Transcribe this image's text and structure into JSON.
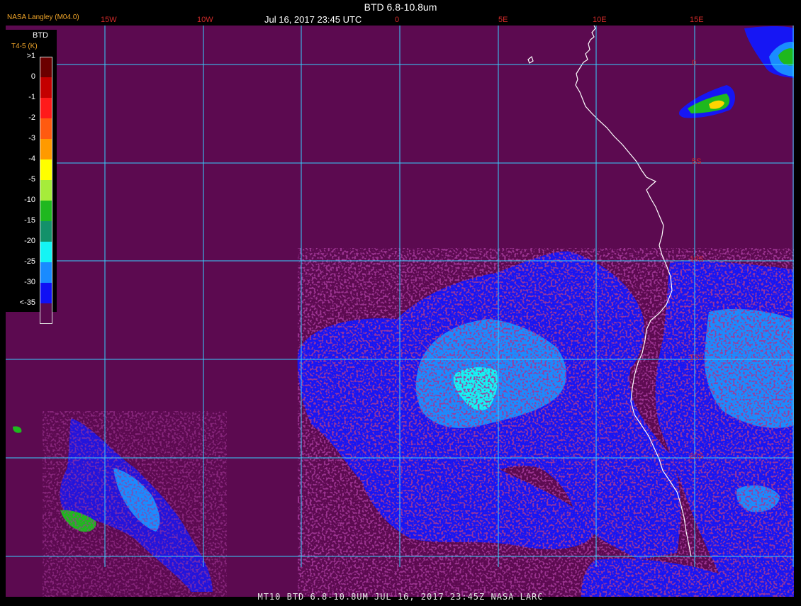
{
  "header": {
    "credit": "NASA Langley (M04.0)",
    "title": "BTD 6.8-10.8um",
    "subtitle": "Jul 16, 2017 23:45 UTC"
  },
  "footer": {
    "caption": "MT10  BTD 6.8-10.8UM   JUL 16, 2017 23:45Z   NASA LARC"
  },
  "longitude_labels": [
    "15W",
    "10W",
    "0",
    "5E",
    "10E",
    "15E"
  ],
  "latitude_labels": [
    "0",
    "5S",
    "10S",
    "15S",
    "20S"
  ],
  "legend": {
    "title": "BTD",
    "units": "T4-5 (K)",
    "labels": [
      ">1",
      "0",
      "-1",
      "-2",
      "-3",
      "-4",
      "-5",
      "-10",
      "-15",
      "-20",
      "-25",
      "-30",
      "<-35"
    ],
    "colors": [
      "#6b0000",
      "#c40000",
      "#ff1a1a",
      "#ff5a10",
      "#ff9a00",
      "#ffff00",
      "#a6ec3a",
      "#1fb81f",
      "#13916a",
      "#14f4f4",
      "#198bff",
      "#1010f4",
      "#5a0a4e"
    ]
  },
  "colors": {
    "background": "#5c0a50",
    "grid": "#36d0ff",
    "coast": "#ffffff",
    "cloud_blue": "#1616f4",
    "cloud_lightblue": "#1a8cff",
    "cloud_cyan": "#14f4f4",
    "cloud_green": "#1eb81e",
    "cloud_yellow": "#ffd400"
  }
}
